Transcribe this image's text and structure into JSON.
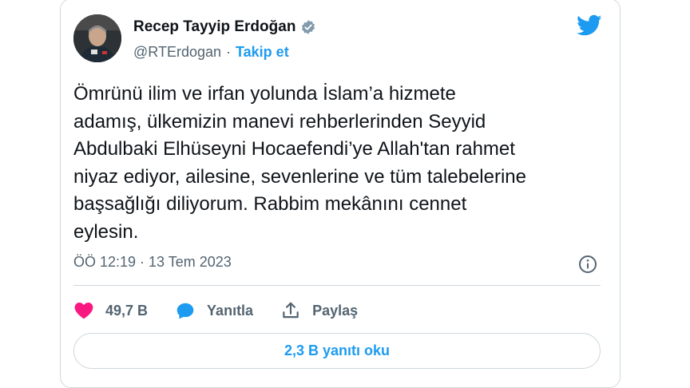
{
  "author": {
    "name": "Recep Tayyip Erdoğan",
    "handle": "@RTErdogan",
    "separator": "·",
    "follow_label": "Takip et"
  },
  "tweet": {
    "text": "Ömrünü ilim ve irfan yolunda İslam’a hizmete\nadamış, ülkemizin manevi rehberlerinden Seyyid\nAbdulbaki Elhüseyni Hocaefendi’ye Allah'tan rahmet\nniyaz ediyor, ailesine, sevenlerine ve tüm talebelerine\nbaşsağlığı diliyorum. Rabbim mekânını cennet\neylesin.",
    "timestamp": "ÖÖ 12:19 · 13 Tem 2023"
  },
  "actions": {
    "like_count": "49,7 B",
    "reply_label": "Yanıtla",
    "share_label": "Paylaş"
  },
  "read_replies_label": "2,3 B yanıtı oku",
  "icons": [
    "verified-badge-icon",
    "twitter-bird-icon",
    "info-icon",
    "heart-icon",
    "reply-bubble-icon",
    "share-icon"
  ],
  "colors": {
    "accent": "#1d9bf0",
    "like": "#f91880",
    "text": "#0f1419",
    "muted": "#536471",
    "border": "#cfd9de"
  }
}
